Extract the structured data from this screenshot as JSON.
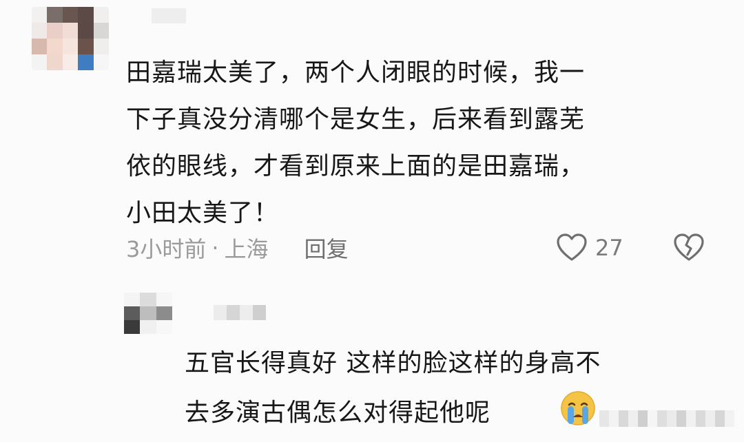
{
  "comment": {
    "lines": [
      "田嘉瑞太美了，两个人闭眼的时候，我一",
      "下子真没分清哪个是女生，后来看到露芜",
      "依的眼线，才看到原来上面的是田嘉瑞，",
      "小田太美了！"
    ],
    "time": "3小时前",
    "separator": "·",
    "location": "上海",
    "reply_label": "回复",
    "like_count": "27",
    "icons": {
      "like": "heart-outline-icon",
      "dislike": "broken-heart-icon"
    }
  },
  "reply": {
    "lines": [
      "五官长得真好 这样的脸这样的身高不",
      "去多演古偶怎么对得起他呢"
    ],
    "emoji": "crying-face-icon"
  },
  "colors": {
    "background": "#fbfbfb",
    "text": "#171717",
    "meta": "#9a9a9a",
    "emoji_face": "#f6c445",
    "emoji_tears": "#5aa7e6"
  }
}
